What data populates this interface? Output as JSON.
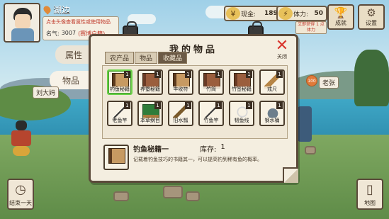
{
  "player": {
    "location": "湖边",
    "hint": "点击头像查看属性或使用物品",
    "fame_label": "名气:",
    "fame_value": "3007",
    "fame_title": "(赛博户籍)"
  },
  "resources": {
    "cash_label": "现金:",
    "cash_value": "1898",
    "stamina_label": "体力:",
    "stamina_value": "50",
    "stamina_timer": "立即获得 1 点体力"
  },
  "top_buttons": {
    "achievement": "成就",
    "settings": "设置"
  },
  "side_tabs": {
    "attributes": "属性",
    "items": "物品"
  },
  "npcs": {
    "left_name": "刘大妈",
    "right_name": "老张",
    "right_badge": "100"
  },
  "bottom_buttons": {
    "end_day": "结束一天",
    "map": "地图"
  },
  "panel": {
    "title": "我的物品",
    "close_label": "关闭",
    "tabs": [
      "农产品",
      "物品",
      "收藏品"
    ],
    "active_tab": "收藏品",
    "items": [
      {
        "name": "钓鱼秘籍",
        "count": "1",
        "icon": "book-icon"
      },
      {
        "name": "养蚕秘籍",
        "count": "1",
        "icon": "book-icon"
      },
      {
        "name": "丰收符",
        "count": "1",
        "icon": "book-icon"
      },
      {
        "name": "竹简",
        "count": "1",
        "icon": "book-icon"
      },
      {
        "name": "竹签秘籍",
        "count": "1",
        "icon": "book-icon"
      },
      {
        "name": "戒尺",
        "count": "1",
        "icon": "ruler-icon"
      },
      {
        "name": "老鱼竿",
        "count": "1",
        "icon": "fishing-rod-icon"
      },
      {
        "name": "本草纲目",
        "count": "1",
        "icon": "certificate-icon"
      },
      {
        "name": "旧水瓢",
        "count": "1",
        "icon": "broom-icon"
      },
      {
        "name": "竹鱼竿",
        "count": "1",
        "icon": "fishing-rod-icon"
      },
      {
        "name": "韧鱼线",
        "count": "1",
        "icon": "fishing-line-icon"
      },
      {
        "name": "钢水桶",
        "count": "1",
        "icon": "water-tank-icon"
      }
    ],
    "detail": {
      "name": "钓鱼秘籍一",
      "stock_label": "库存:",
      "stock_value": "1",
      "description": "记载着钓鱼技巧的书籍其一，可以提高钓到稀有鱼的概率。"
    }
  }
}
